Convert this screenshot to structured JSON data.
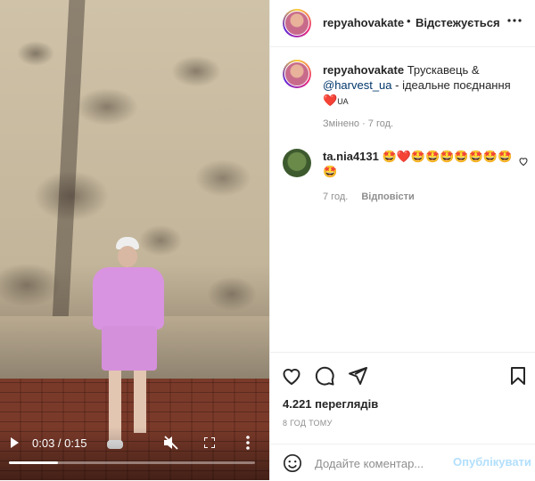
{
  "video": {
    "time": "0:03 / 0:15",
    "progress": 0.2
  },
  "post": {
    "author": "repyahovakate",
    "dot": "•",
    "follow_label": "Відстежується",
    "caption_username": "repyahovakate",
    "caption_text_1": "Трускавець & ",
    "caption_mention": "@harvest_ua",
    "caption_text_2": " - ідеальне поєднання ",
    "caption_emoji": "❤️",
    "caption_text_3": "UA",
    "edited": "Змінено · 7 год.",
    "comment": {
      "username": "ta.nia4131",
      "text": "🤩❤️🤩🤩🤩🤩🤩🤩🤩",
      "text_2": "🤩",
      "time": "7 год.",
      "reply_label": "Відповісти"
    },
    "views": "4.221 переглядів",
    "ago": "8 ГОД ТОМУ",
    "comment_placeholder": "Додайте коментар...",
    "post_label": "Опублікувати"
  },
  "colors": {
    "accent": "#0095f6",
    "muted": "#8e8e8e",
    "mention": "#00376b"
  }
}
